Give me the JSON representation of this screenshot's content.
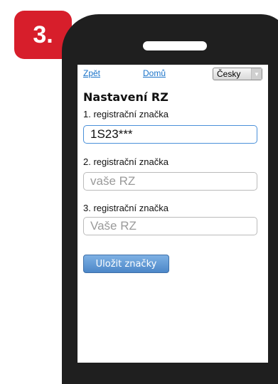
{
  "badge": {
    "step": "3."
  },
  "nav": {
    "back": "Zpět",
    "home": "Domů",
    "language": "Česky"
  },
  "page": {
    "title": "Nastavení RZ"
  },
  "plates": [
    {
      "label": "1. registrační značka",
      "value": "1S23***",
      "placeholder": ""
    },
    {
      "label": "2. registrační značka",
      "value": "",
      "placeholder": "vaše RZ"
    },
    {
      "label": "3. registrační značka",
      "value": "",
      "placeholder": "Vaše RZ"
    }
  ],
  "actions": {
    "save": "Uložit značky"
  },
  "colors": {
    "badge": "#d71e2b",
    "button": "#4c87c8",
    "link": "#1a73c9"
  }
}
